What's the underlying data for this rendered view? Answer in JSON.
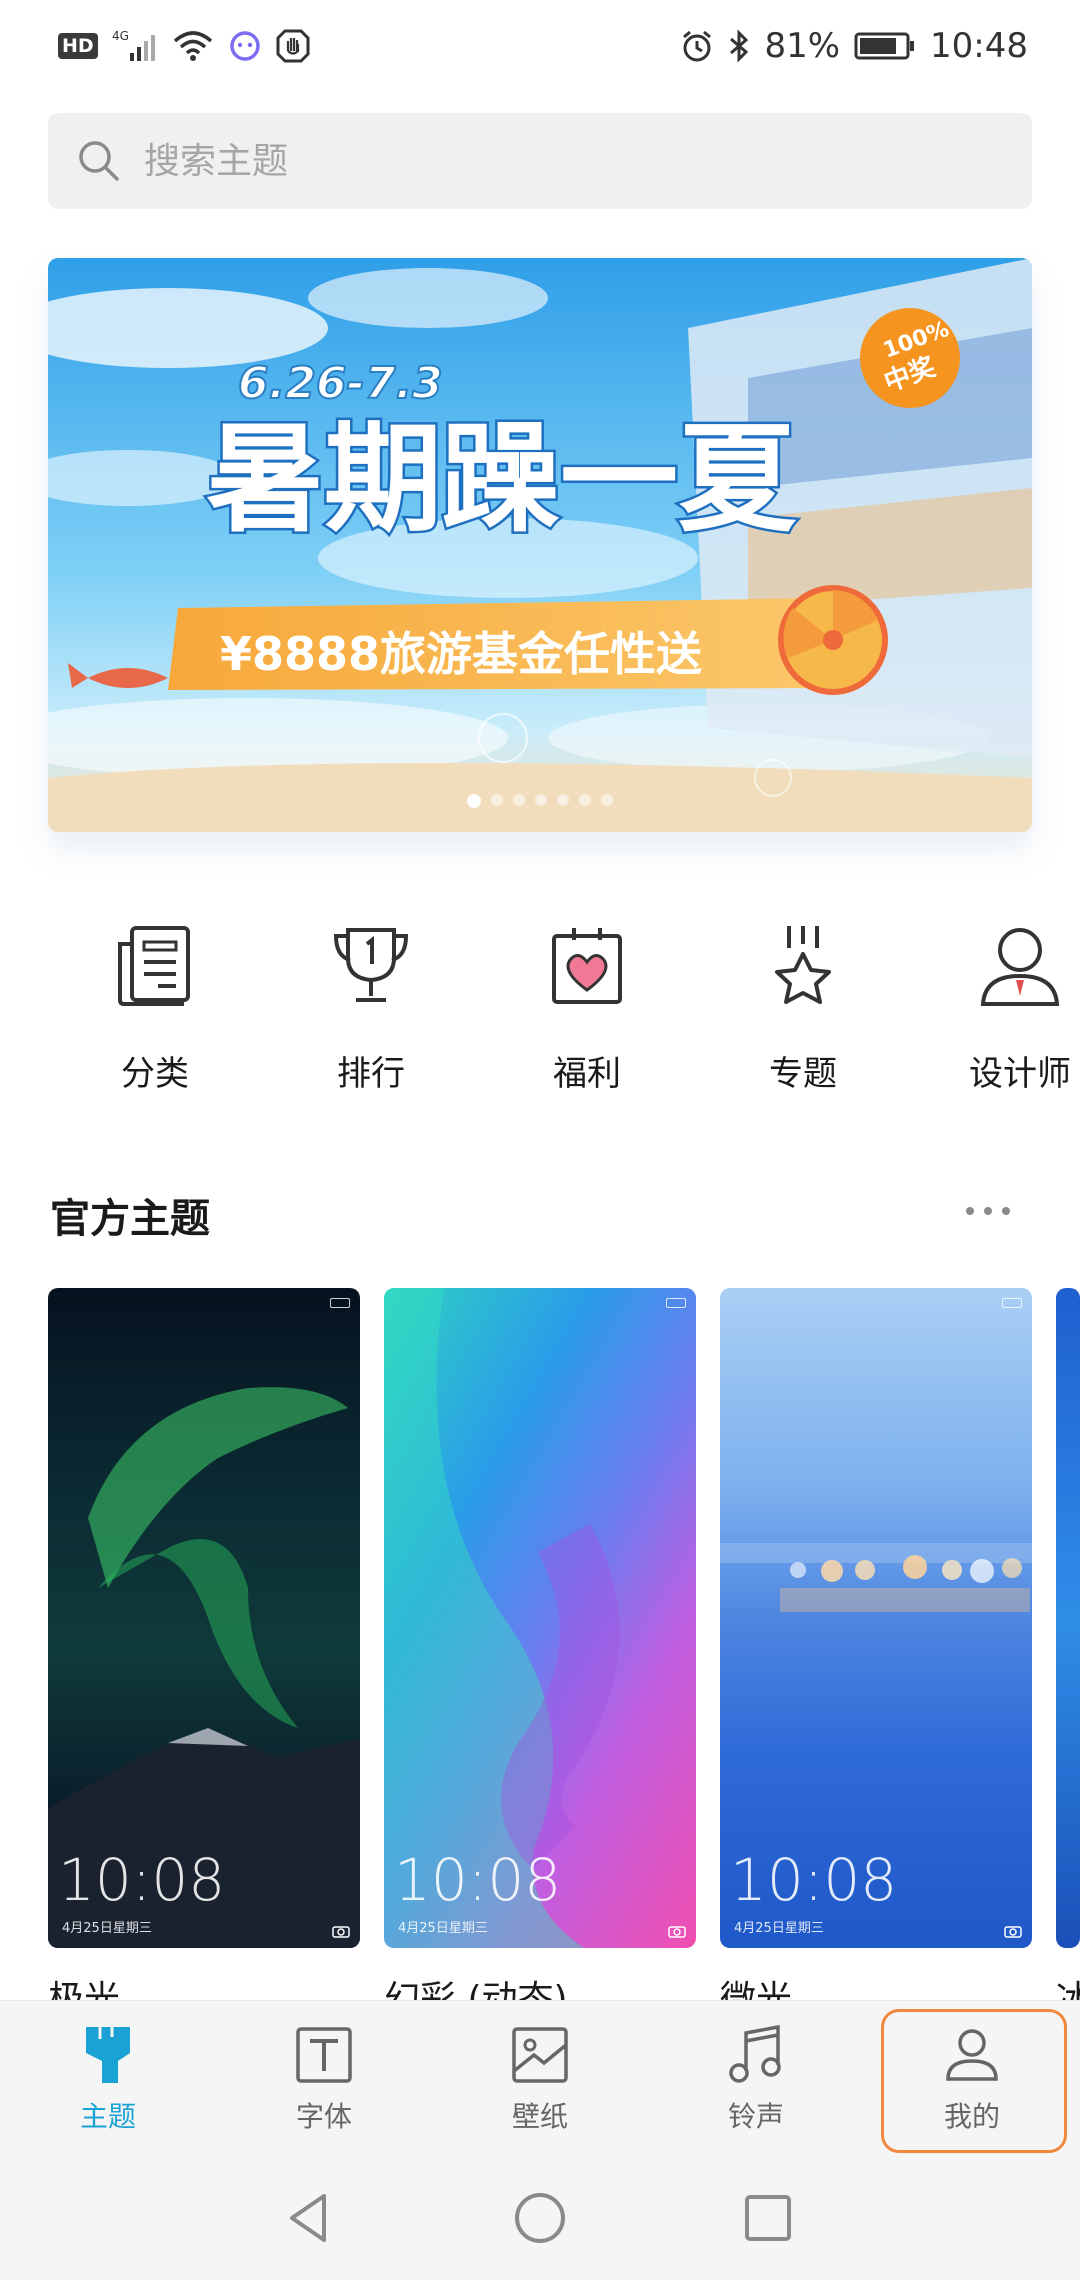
{
  "status_bar": {
    "hd": "HD",
    "network": "4G",
    "battery_percent": "81%",
    "time": "10:48",
    "icons": [
      "signal-icon",
      "wifi-icon",
      "assistant-icon",
      "hand-icon",
      "alarm-icon",
      "bluetooth-icon",
      "battery-icon"
    ]
  },
  "search": {
    "placeholder": "搜索主题",
    "value": ""
  },
  "banner": {
    "date_range": "6.26-7.3",
    "headline": "暑期躁一夏",
    "badge_line1": "100%",
    "badge_line2": "中奖",
    "prize_text": "¥8888旅游基金任性送",
    "slide_count": 7,
    "active_slide": 1,
    "colors": {
      "sky": "#46b3ef",
      "ribbon": "#f7a83a",
      "badge": "#f5941e"
    }
  },
  "shortcuts": [
    {
      "label": "分类",
      "icon": "category-icon"
    },
    {
      "label": "排行",
      "icon": "trophy-icon"
    },
    {
      "label": "福利",
      "icon": "gift-icon"
    },
    {
      "label": "专题",
      "icon": "star-topic-icon"
    },
    {
      "label": "设计师",
      "icon": "designer-icon"
    }
  ],
  "section": {
    "title": "官方主题"
  },
  "themes": [
    {
      "name": "极光",
      "preview_time": "10:08",
      "preview_date": "4月25日星期三"
    },
    {
      "name": "幻彩 (动态)",
      "preview_time": "10:08",
      "preview_date": "4月25日星期三"
    },
    {
      "name": "微光",
      "preview_time": "10:08",
      "preview_date": "4月25日星期三"
    },
    {
      "name": "冰"
    }
  ],
  "bottom_nav": {
    "active_index": 0,
    "highlight_index": 4,
    "accent_color": "#1aa2d4",
    "highlight_color": "#f0883e",
    "items": [
      {
        "label": "主题",
        "icon": "theme-brush-icon"
      },
      {
        "label": "字体",
        "icon": "font-icon"
      },
      {
        "label": "壁纸",
        "icon": "wallpaper-icon"
      },
      {
        "label": "铃声",
        "icon": "music-note-icon"
      },
      {
        "label": "我的",
        "icon": "person-icon"
      }
    ]
  }
}
